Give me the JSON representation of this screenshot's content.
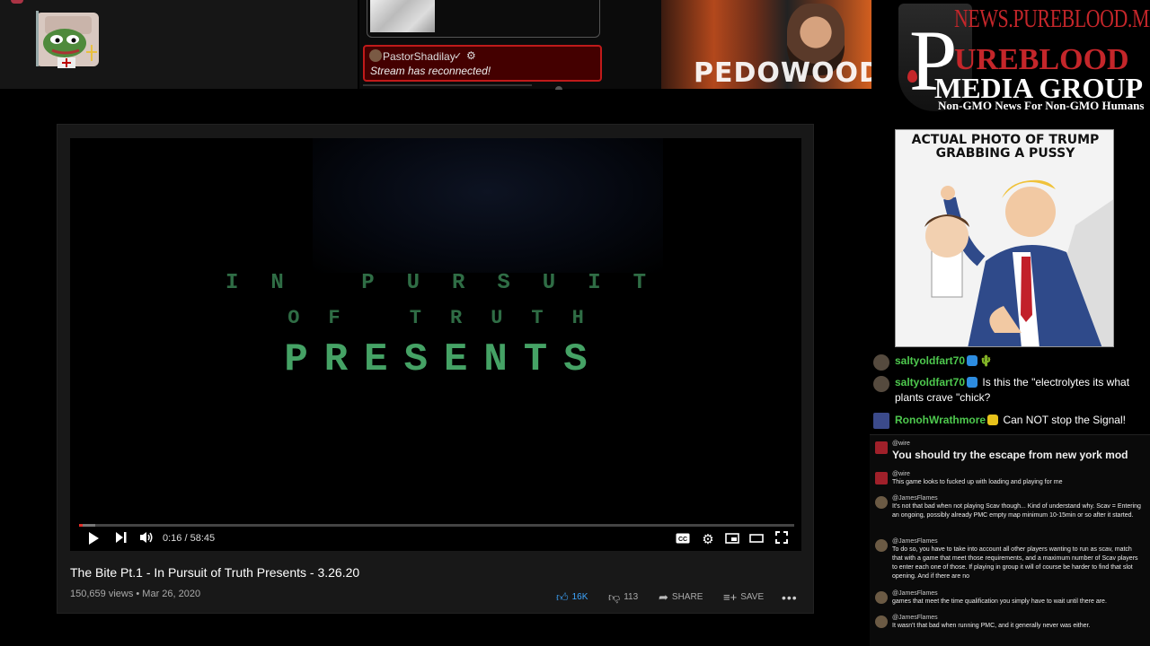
{
  "top_strip": {
    "reconnect_user": "PastorShadilay",
    "reconnect_check": "✓",
    "reconnect_message": "Stream has reconnected!",
    "overlay_image_text": "PEDOWOOD"
  },
  "brand": {
    "url": "NEWS.PUREBLOOD.MEDIA",
    "line1": "UREBLOOD",
    "line2": "MEDIA GROUP",
    "cross_letter": "P",
    "tagline": "Non-GMO News For Non-GMO Humans"
  },
  "meme": {
    "caption": "ACTUAL PHOTO OF TRUMP GRABBING A PUSSY"
  },
  "chat": [
    {
      "user": "saltyoldfart70",
      "badge": "blue",
      "text": ""
    },
    {
      "user": "saltyoldfart70",
      "badge": "blue",
      "text": "Is this the \"electrolytes its what plants crave \"chick?"
    },
    {
      "user": "RonohWrathmore",
      "badge": "gold",
      "text": "Can NOT stop the Signal!"
    }
  ],
  "mini_chat": [
    {
      "user": "@wire",
      "text": "You should try the escape from new york mod",
      "big": true,
      "avatar": "red"
    },
    {
      "user": "@wire",
      "text": "This game looks to fucked up with loading and playing for me",
      "big": false,
      "avatar": "red"
    },
    {
      "user": "@JamesFlames",
      "text": "It's not that bad when not playing Scav though... Kind of understand why. Scav = Entering an ongoing, possibly already PMC empty map minimum 10-15min or so after it started.",
      "big": false,
      "avatar": "face"
    },
    {
      "user": "@JamesFlames",
      "text": "To do so, you have to take into account all other players wanting to run as scav, match that with a game that meet those requirements, and a maximum number of Scav players to enter each one of those. If playing in group it will of course be harder to find that slot opening. And if there are no",
      "big": false,
      "avatar": "face"
    },
    {
      "user": "@JamesFlames",
      "text": "games that meet the time qualification you simply have to wait until there are.",
      "big": false,
      "avatar": "face"
    },
    {
      "user": "@JamesFlames",
      "text": "It wasn't that bad when running PMC, and it generally never was either.",
      "big": false,
      "avatar": "face"
    }
  ],
  "video": {
    "title_line1": [
      "I",
      "N",
      " ",
      "P",
      "U",
      "R",
      "S",
      "U",
      "I",
      "T"
    ],
    "title_line1_text": "IN PURSUIT",
    "title_line2_text": "OF TRUTH",
    "title_line3_text": "PRESENTS",
    "progress_fraction": 0.0046,
    "buffer_fraction": 0.022,
    "time_readout": "0:16 / 58:45",
    "title": "The Bite Pt.1 - In Pursuit of Truth Presents - 3.26.20",
    "meta": "150,659 views • Mar 26, 2020",
    "likes": "16K",
    "dislikes": "113",
    "share_label": "SHARE",
    "save_label": "SAVE"
  },
  "colors": {
    "accent_red": "#c4262a",
    "chat_username": "#4ec94e",
    "like_blue": "#3ea6ff",
    "title_green": "#45a265"
  }
}
